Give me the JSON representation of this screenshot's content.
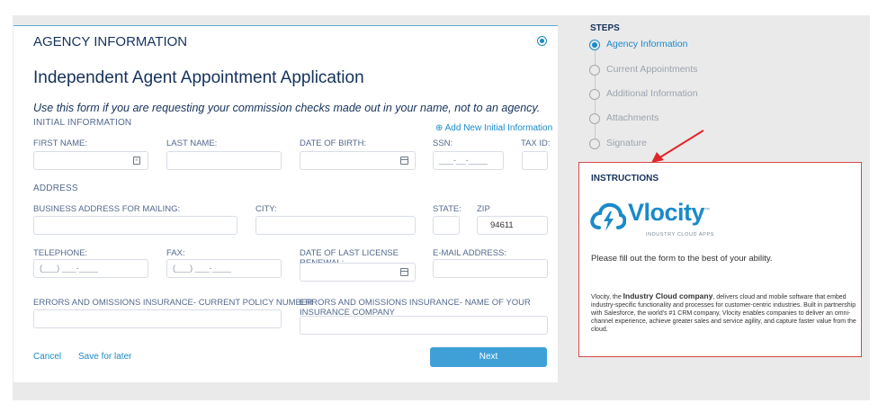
{
  "form": {
    "section_header": "AGENCY INFORMATION",
    "title": "Independent Agent Appointment Application",
    "instructions_line": "Use this form if you are requesting your commission checks made out in your name, not to an agency.",
    "initial_info_label": "INITIAL INFORMATION",
    "add_initial_link": "Add New Initial Information",
    "first_name_label": "FIRST NAME:",
    "last_name_label": "LAST NAME:",
    "dob_label": "DATE OF BIRTH:",
    "ssn_label": "SSN:",
    "tax_id_label": "TAX ID:",
    "ssn_placeholder": "___-__-____",
    "address_label": "ADDRESS",
    "business_address_label": "BUSINESS ADDRESS FOR MAILING:",
    "city_label": "CITY:",
    "state_label": "STATE:",
    "zip_label": "ZIP",
    "zip_value": "94611",
    "telephone_label": "TELEPHONE:",
    "telephone_placeholder": "(___) ___-____",
    "fax_label": "FAX:",
    "fax_placeholder": "(___) ___-____",
    "license_renewal_label": "DATE OF LAST LICENSE RENEWAL:",
    "email_label": "E-MAIL ADDRESS:",
    "eo_policy_label": "ERRORS AND OMISSIONS INSURANCE- CURRENT POLICY NUMBER",
    "eo_company_label": "ERRORS AND OMISSIONS INSURANCE- NAME OF YOUR INSURANCE COMPANY",
    "cancel_label": "Cancel",
    "save_later_label": "Save for later",
    "next_label": "Next"
  },
  "steps": {
    "title": "STEPS",
    "items": [
      {
        "label": "Agency Information"
      },
      {
        "label": "Current Appointments"
      },
      {
        "label": "Additional Information"
      },
      {
        "label": "Attachments"
      },
      {
        "label": "Signature"
      }
    ]
  },
  "instructions": {
    "title": "INSTRUCTIONS",
    "logo_text": "Vlocity",
    "logo_tm": "™",
    "logo_subtitle": "INDUSTRY CLOUD APPS",
    "message": "Please fill out the form to the best of your ability.",
    "body_pre": "Vlocity, the ",
    "body_bold": "Industry Cloud company",
    "body_post": ", delivers cloud and mobile software that embed industry-specific functionality and processes for customer-centric industries. Built in partnership with Salesforce, the world's #1 CRM company, Vlocity enables companies to deliver an omni-channel experience, achieve greater sales and service agility, and capture faster value from the cloud."
  },
  "colors": {
    "accent": "#1a8ac9",
    "next_button": "#3fa0d8",
    "highlight_border": "#d94848",
    "arrow": "#e0262b"
  }
}
